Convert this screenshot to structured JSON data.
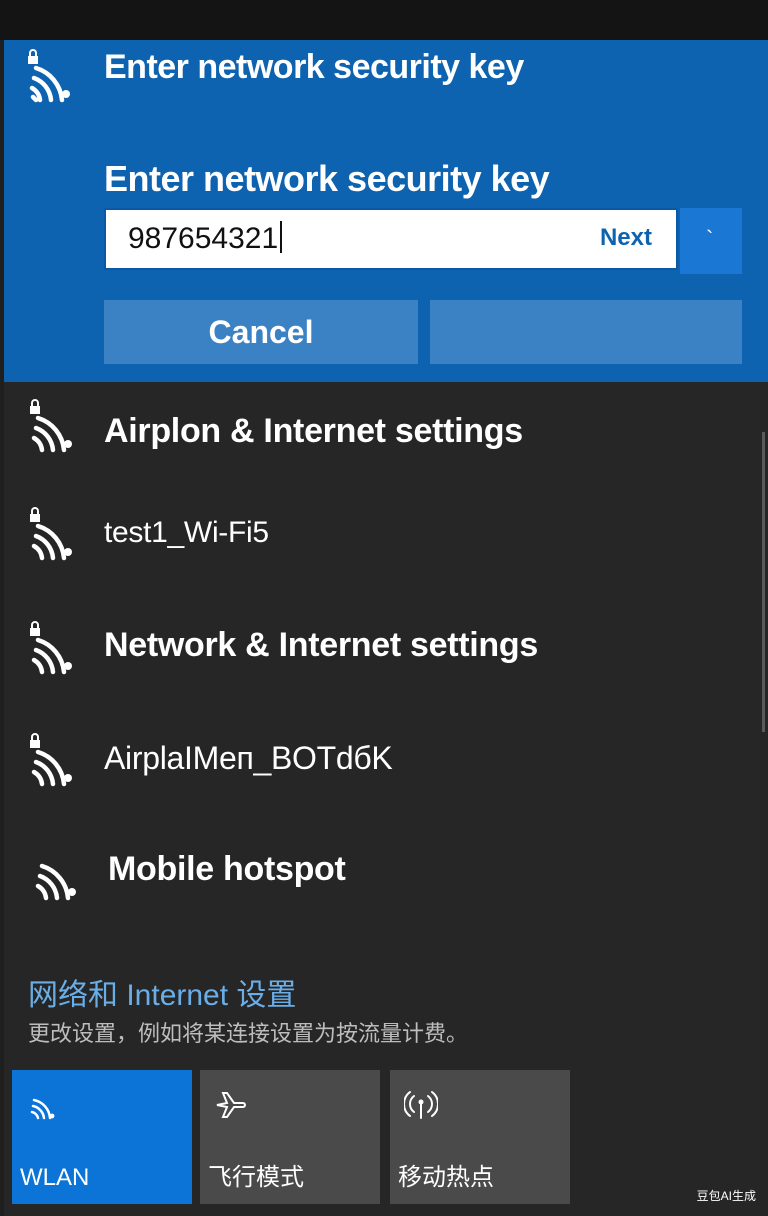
{
  "active_network": {
    "name": "Enter network security key",
    "prompt": "Enter network security key",
    "key_value": "987654321",
    "next_label": "Next",
    "reveal_glyph": "`",
    "cancel_label": "Cancel",
    "connect_label": ""
  },
  "networks": [
    {
      "name": "Airplon & Internet settings",
      "secured": true
    },
    {
      "name": "test1_Wi-Fi5",
      "secured": true
    },
    {
      "name": "Network & Internet settings",
      "secured": true
    },
    {
      "name": "AirplaIMeп_BOTdбK",
      "secured": true
    },
    {
      "name": "Mobile hotspot",
      "secured": false
    }
  ],
  "settings": {
    "link": "网络和 Internet 设置",
    "description": "更改设置，例如将某连接设置为按流量计费。"
  },
  "quick_actions": [
    {
      "label": "WLAN",
      "icon": "wifi-icon",
      "active": true
    },
    {
      "label": "飞行模式",
      "icon": "airplane-icon",
      "active": false
    },
    {
      "label": "移动热点",
      "icon": "hotspot-icon",
      "active": false
    }
  ],
  "watermark": "豆包AI生成",
  "colors": {
    "accent": "#0e63b0",
    "tile_active": "#0b74d6",
    "link": "#6aaee8"
  }
}
